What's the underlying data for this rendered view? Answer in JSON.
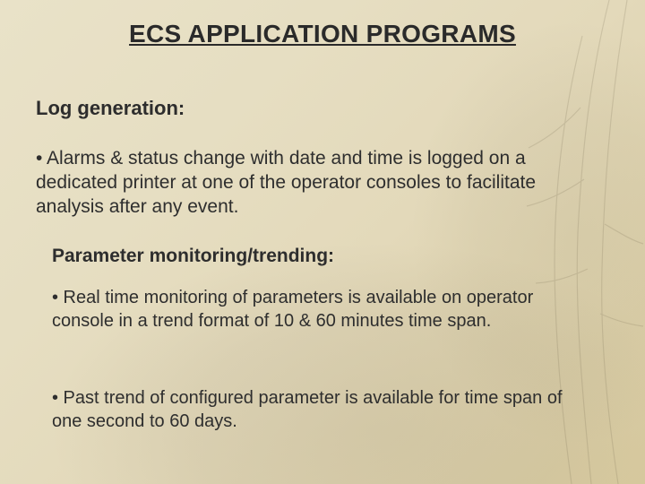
{
  "title": "ECS APPLICATION PROGRAMS",
  "section1": {
    "heading": "Log generation:",
    "bullet": "• Alarms & status change  with date and time is logged on a dedicated printer at one of the operator consoles to facilitate analysis after any event."
  },
  "section2": {
    "heading": "Parameter monitoring/trending:",
    "bullet1": "• Real time monitoring of parameters is available on operator console in a  trend format of 10  & 60 minutes time span.",
    "bullet2": "• Past trend of configured parameter is available for time span of one second to 60 days."
  }
}
